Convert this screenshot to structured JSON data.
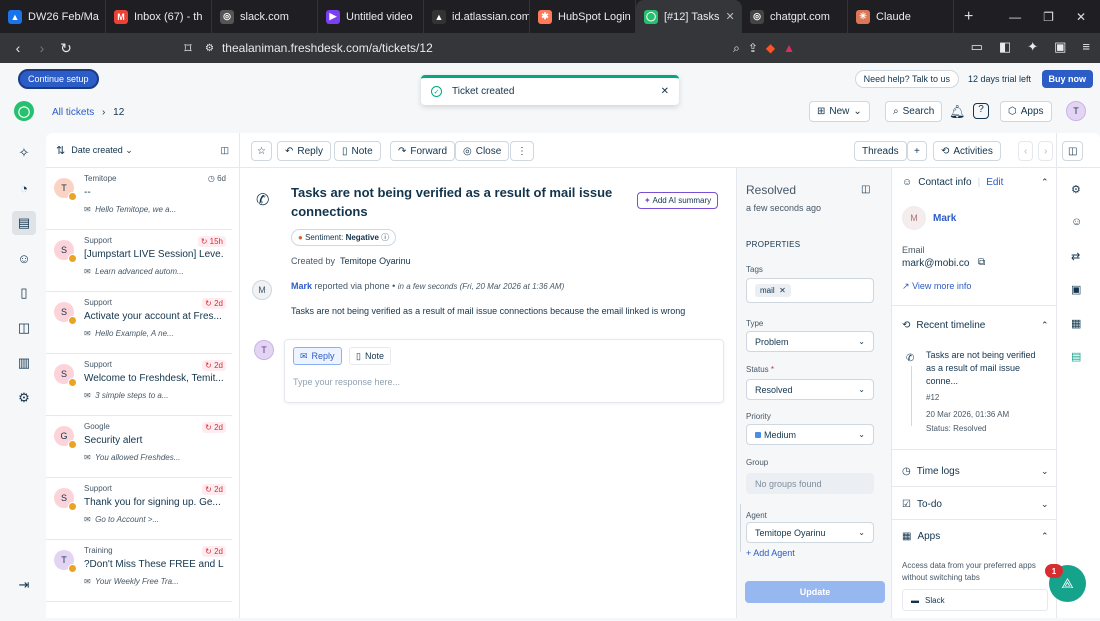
{
  "tabs": [
    {
      "title": "DW26 Feb/Ma",
      "color": "#1a73e8",
      "glyph": "▲"
    },
    {
      "title": "Inbox (67) - th",
      "color": "#ea4335",
      "glyph": "M"
    },
    {
      "title": "slack.com",
      "color": "#555",
      "glyph": "◎"
    },
    {
      "title": "Untitled video",
      "color": "#7b3ff2",
      "glyph": "▶"
    },
    {
      "title": "id.atlassian.com",
      "color": "#333",
      "glyph": "▲"
    },
    {
      "title": "HubSpot Login",
      "color": "#ff7a59",
      "glyph": "✱"
    },
    {
      "title": "[#12] Tasks",
      "color": "#25c16f",
      "glyph": "◯"
    },
    {
      "title": "chatgpt.com",
      "color": "#444",
      "glyph": "◎"
    },
    {
      "title": "Claude",
      "color": "#d97757",
      "glyph": "✳"
    }
  ],
  "browser": {
    "url": "thealaniman.freshdesk.com/a/tickets/12"
  },
  "banner": {
    "continue": "Continue setup",
    "help": "Need help? Talk to us",
    "trial": "12 days trial left",
    "buy": "Buy now"
  },
  "toast": {
    "text": "Ticket created"
  },
  "header": {
    "all_tickets": "All tickets",
    "ticket_id": "12",
    "new": "New",
    "search": "Search",
    "apps": "Apps",
    "avatar": "T"
  },
  "list": {
    "sort": "Date created",
    "items": [
      {
        "avatar": "T",
        "avatar_bg": "#fbd3c4",
        "from": "Temitope",
        "subject": "--",
        "preview": "Hello Temitope, we a...",
        "time": "6d",
        "sla": false
      },
      {
        "avatar": "S",
        "avatar_bg": "#fbd3d8",
        "from": "Support",
        "subject": "[Jumpstart LIVE Session] Leve...",
        "preview": "Learn advanced autom...",
        "time": "15h",
        "sla": true
      },
      {
        "avatar": "S",
        "avatar_bg": "#fbd3d8",
        "from": "Support",
        "subject": "Activate your account at Fres...",
        "preview": "Hello Example, A ne...",
        "time": "2d",
        "sla": true
      },
      {
        "avatar": "S",
        "avatar_bg": "#fbd3d8",
        "from": "Support",
        "subject": "Welcome to Freshdesk, Temit...",
        "preview": "3 simple steps to a...",
        "time": "2d",
        "sla": true
      },
      {
        "avatar": "G",
        "avatar_bg": "#fbd3d8",
        "from": "Google",
        "subject": "Security alert",
        "preview": "You allowed Freshdes...",
        "time": "2d",
        "sla": true
      },
      {
        "avatar": "S",
        "avatar_bg": "#fbd3d8",
        "from": "Support",
        "subject": "Thank you for signing up. Ge...",
        "preview": "Go to Account >...",
        "time": "2d",
        "sla": true
      },
      {
        "avatar": "T",
        "avatar_bg": "#e4d4f4",
        "from": "Training",
        "subject": "?Don't Miss These FREE and L...",
        "preview": "Your Weekly Free Tra...",
        "time": "2d",
        "sla": true
      }
    ]
  },
  "toolbar": {
    "reply": "Reply",
    "note": "Note",
    "forward": "Forward",
    "close": "Close",
    "threads": "Threads",
    "activities": "Activities"
  },
  "ticket": {
    "title": "Tasks are not being verified as a result of mail issue connections",
    "ai_summary": "Add AI summary",
    "sentiment_label": "Sentiment:",
    "sentiment_value": "Negative",
    "created_by_label": "Created by",
    "created_by": "Temitope Oyarinu",
    "author": "Mark",
    "author_initial": "M",
    "via": "reported via phone",
    "time": "in a few seconds (Fri, 20 Mar 2026 at 1:36 AM)",
    "body": "Tasks are not being verified as a result of mail issue connections because the email linked is wrong",
    "reply_tab": "Reply",
    "note_tab": "Note",
    "reply_placeholder": "Type your response here...",
    "reply_avatar": "T"
  },
  "props": {
    "status_title": "Resolved",
    "status_time": "a few seconds ago",
    "heading": "PROPERTIES",
    "tags_label": "Tags",
    "tag": "mail",
    "type_label": "Type",
    "type_value": "Problem",
    "status_label": "Status",
    "status_value": "Resolved",
    "priority_label": "Priority",
    "priority_value": "Medium",
    "priority_color": "#4a90e2",
    "group_label": "Group",
    "group_value": "No groups found",
    "agent_label": "Agent",
    "agent_value": "Temitope Oyarinu",
    "add_agent": "+ Add Agent",
    "update": "Update"
  },
  "contact": {
    "title": "Contact info",
    "edit": "Edit",
    "name": "Mark",
    "initial": "M",
    "email_label": "Email",
    "email": "mark@mobi.co",
    "view_more": "View more info",
    "timeline_title": "Recent timeline",
    "tl_text": "Tasks are not being verified as a result of mail issue conne...",
    "tl_id": "#12",
    "tl_time": "20 Mar 2026, 01:36 AM",
    "tl_status": "Status: Resolved",
    "time_logs": "Time logs",
    "todo": "To-do",
    "apps": "Apps",
    "apps_desc": "Access data from your preferred apps without switching tabs",
    "slack": "Slack"
  },
  "fab": {
    "badge": "1"
  }
}
